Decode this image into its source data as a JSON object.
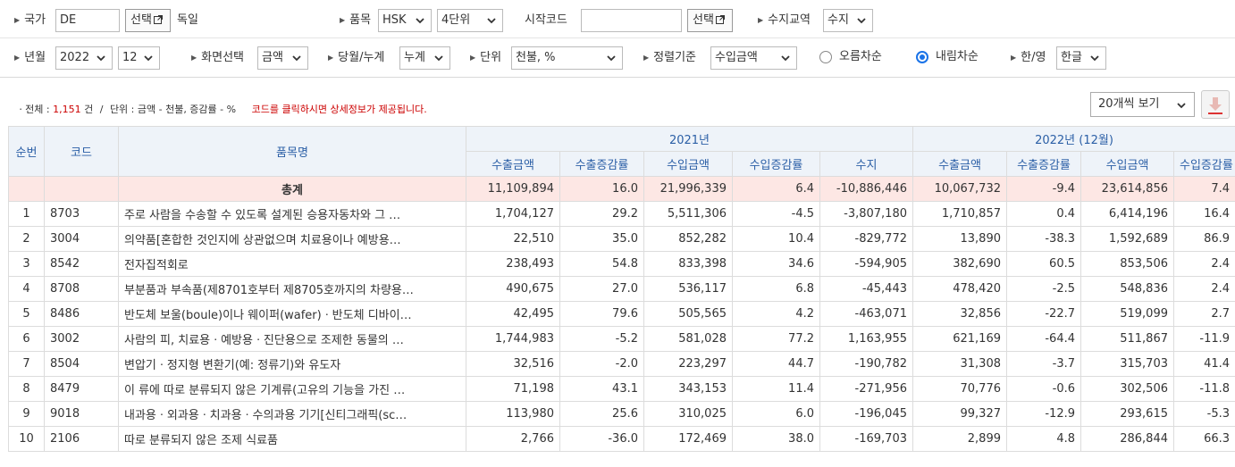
{
  "filters": {
    "country": {
      "label": "국가",
      "value": "DE",
      "select_button": "선택",
      "name": "독일"
    },
    "item": {
      "label": "품목",
      "type": "HSK",
      "digits": "4단위"
    },
    "start_code": {
      "label": "시작코드",
      "value": "",
      "select_button": "선택"
    },
    "trade_type": {
      "label": "수지교역",
      "value": "수지"
    },
    "year_month": {
      "label": "년월",
      "year": "2022",
      "month": "12"
    },
    "screen": {
      "label": "화면선택",
      "value": "금액"
    },
    "period": {
      "label": "당월/누계",
      "value": "누계"
    },
    "unit": {
      "label": "단위",
      "value": "천불, %"
    },
    "sort": {
      "label": "정렬기준",
      "value": "수입금액"
    },
    "asc_label": "오름차순",
    "desc_label": "내림차순",
    "lang": {
      "label": "한/영",
      "value": "한글"
    }
  },
  "info": {
    "total_label": "전체",
    "count": "1,151",
    "count_unit": "건",
    "unit_text": "단위 : 금액 - 천불, 증감률 - %",
    "notice": "코드를 클릭하시면 상세정보가 제공됩니다."
  },
  "page_size": "20개씩 보기",
  "table": {
    "headers": {
      "rank": "순번",
      "code": "코드",
      "name": "품목명",
      "group1": "2021년",
      "group2": "2022년 (12월)",
      "export_amt": "수출금액",
      "export_rate": "수출증감률",
      "import_amt": "수입금액",
      "import_rate": "수입증감률",
      "balance": "수지"
    },
    "total": {
      "name": "총계",
      "v": [
        "11,109,894",
        "16.0",
        "21,996,339",
        "6.4",
        "-10,886,446",
        "10,067,732",
        "-9.4",
        "23,614,856",
        "7.4"
      ]
    },
    "rows": [
      {
        "rank": "1",
        "code": "8703",
        "name": "주로 사람을 수송할 수 있도록 설계된 승용자동차와 그 …",
        "v": [
          "1,704,127",
          "29.2",
          "5,511,306",
          "-4.5",
          "-3,807,180",
          "1,710,857",
          "0.4",
          "6,414,196",
          "16.4"
        ]
      },
      {
        "rank": "2",
        "code": "3004",
        "name": "의약품[혼합한 것인지에 상관없으며 치료용이나 예방용…",
        "v": [
          "22,510",
          "35.0",
          "852,282",
          "10.4",
          "-829,772",
          "13,890",
          "-38.3",
          "1,592,689",
          "86.9"
        ]
      },
      {
        "rank": "3",
        "code": "8542",
        "name": "전자집적회로",
        "v": [
          "238,493",
          "54.8",
          "833,398",
          "34.6",
          "-594,905",
          "382,690",
          "60.5",
          "853,506",
          "2.4"
        ]
      },
      {
        "rank": "4",
        "code": "8708",
        "name": "부분품과 부속품(제8701호부터 제8705호까지의 차량용…",
        "v": [
          "490,675",
          "27.0",
          "536,117",
          "6.8",
          "-45,443",
          "478,420",
          "-2.5",
          "548,836",
          "2.4"
        ]
      },
      {
        "rank": "5",
        "code": "8486",
        "name": "반도체 보울(boule)이나 웨이퍼(wafer)ㆍ반도체 디바이…",
        "v": [
          "42,495",
          "79.6",
          "505,565",
          "4.2",
          "-463,071",
          "32,856",
          "-22.7",
          "519,099",
          "2.7"
        ]
      },
      {
        "rank": "6",
        "code": "3002",
        "name": "사람의 피, 치료용ㆍ예방용ㆍ진단용으로 조제한 동물의 …",
        "v": [
          "1,744,983",
          "-5.2",
          "581,028",
          "77.2",
          "1,163,955",
          "621,169",
          "-64.4",
          "511,867",
          "-11.9"
        ]
      },
      {
        "rank": "7",
        "code": "8504",
        "name": "변압기ㆍ정지형 변환기(예: 정류기)와 유도자",
        "v": [
          "32,516",
          "-2.0",
          "223,297",
          "44.7",
          "-190,782",
          "31,308",
          "-3.7",
          "315,703",
          "41.4"
        ]
      },
      {
        "rank": "8",
        "code": "8479",
        "name": "이 류에 따로 분류되지 않은 기계류(고유의 기능을 가진 …",
        "v": [
          "71,198",
          "43.1",
          "343,153",
          "11.4",
          "-271,956",
          "70,776",
          "-0.6",
          "302,506",
          "-11.8"
        ]
      },
      {
        "rank": "9",
        "code": "9018",
        "name": "내과용ㆍ외과용ㆍ치과용ㆍ수의과용 기기[신티그래픽(sc…",
        "v": [
          "113,980",
          "25.6",
          "310,025",
          "6.0",
          "-196,045",
          "99,327",
          "-12.9",
          "293,615",
          "-5.3"
        ]
      },
      {
        "rank": "10",
        "code": "2106",
        "name": "따로 분류되지 않은 조제 식료품",
        "v": [
          "2,766",
          "-36.0",
          "172,469",
          "38.0",
          "-169,703",
          "2,899",
          "4.8",
          "286,844",
          "66.3"
        ]
      }
    ]
  }
}
